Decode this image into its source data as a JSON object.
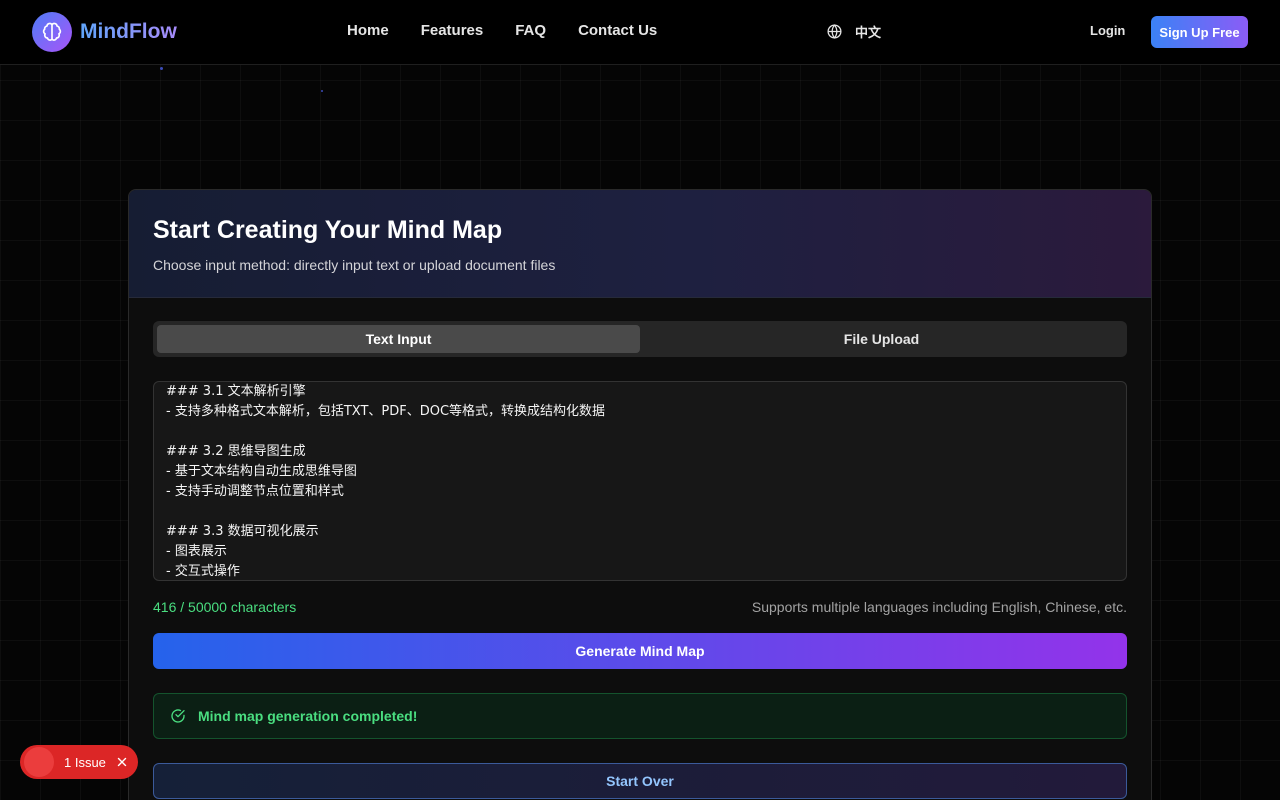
{
  "nav": {
    "brand": "MindFlow",
    "links": [
      "Home",
      "Features",
      "FAQ",
      "Contact Us"
    ],
    "language": "中文",
    "login": "Login",
    "signup": "Sign Up Free"
  },
  "card": {
    "title": "Start Creating Your Mind Map",
    "subtitle": "Choose input method: directly input text or upload document files",
    "tabs": [
      {
        "label": "Text Input",
        "active": true
      },
      {
        "label": "File Upload",
        "active": false
      }
    ],
    "textarea_value": "### 3.1 文本解析引擎\n- 支持多种格式文本解析，包括TXT、PDF、DOC等格式，转换成结构化数据\n\n### 3.2 思维导图生成\n- 基于文本结构自动生成思维导图\n- 支持手动调整节点位置和样式\n\n### 3.3 数据可视化展示\n- 图表展示\n- 交互式操作",
    "char_count": "416 / 50000 characters",
    "support_note": "Supports multiple languages including English, Chinese, etc.",
    "generate_label": "Generate Mind Map",
    "success_message": "Mind map generation completed!",
    "start_over_label": "Start Over"
  },
  "issue_badge": {
    "label": "1 Issue"
  },
  "colors": {
    "accent_blue": "#3b82f6",
    "accent_purple": "#8b5cf6",
    "success_green": "#4ade80",
    "issue_red": "#dc2626"
  }
}
